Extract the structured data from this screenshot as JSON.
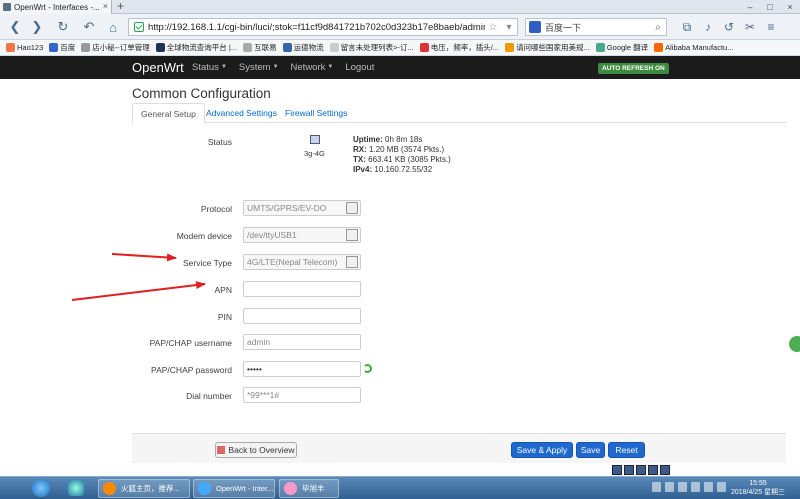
{
  "browser": {
    "tab_title": "OpenWrt - Interfaces -...",
    "url": "http://192.168.1.1/cgi-bin/luci/;stok=f11cf9d841721b702c0d323b17e8baeb/admin/ne",
    "search_text": "百度一下",
    "bookmarks": [
      "Hao123",
      "百度",
      "店小秘--订单管理",
      "全球物流查询平台 |...",
      "互联易",
      "运德物流",
      "留言未处理列表>-订...",
      "电压，频率，插头/...",
      "请问哪些国家用美规...",
      "Google 翻译",
      "Alibaba Manufactu..."
    ]
  },
  "header": {
    "brand": "OpenWrt",
    "menu": [
      "Status",
      "System",
      "Network",
      "Logout"
    ],
    "auto_refresh": "AUTO REFRESH ON"
  },
  "main": {
    "title": "Common Configuration",
    "tabs": [
      "General Setup",
      "Advanced Settings",
      "Firewall Settings"
    ],
    "status": {
      "label": "Status",
      "iface": "3g-4G",
      "uptime_k": "Uptime:",
      "uptime_v": "0h 8m 18s",
      "rx_k": "RX:",
      "rx_v": "1.20 MB (3574 Pkts.)",
      "tx_k": "TX:",
      "tx_v": "663.41 KB (3085 Pkts.)",
      "ipv4_k": "IPv4:",
      "ipv4_v": "10.160.72.55/32"
    },
    "fields": {
      "protocol": {
        "label": "Protocol",
        "value": "UMTS/GPRS/EV-DO"
      },
      "modem": {
        "label": "Modem device",
        "value": "/dev/ttyUSB1"
      },
      "service": {
        "label": "Service Type",
        "value": "4G/LTE(Nepal Telecom)"
      },
      "apn": {
        "label": "APN",
        "value": ""
      },
      "pin": {
        "label": "PIN",
        "value": ""
      },
      "username": {
        "label": "PAP/CHAP username",
        "value": "admin"
      },
      "password": {
        "label": "PAP/CHAP password",
        "value": "•••••"
      },
      "dial": {
        "label": "Dial number",
        "value": "*99***1#"
      }
    }
  },
  "footer": {
    "back": "Back to Overview",
    "save_apply": "Save & Apply",
    "save": "Save",
    "reset": "Reset"
  },
  "taskbar": {
    "tasks": [
      "火狐主页，推荐...",
      "OpenWrt - Inter...",
      "毕旭丰"
    ],
    "time": "15:55",
    "date": "2018/4/25 星期三"
  },
  "colors": {
    "header_bg": "#1b1b1b",
    "accent_blue": "#1e68cf",
    "arrow_red": "#e02020",
    "refresh_green": "#3e8a3e"
  }
}
